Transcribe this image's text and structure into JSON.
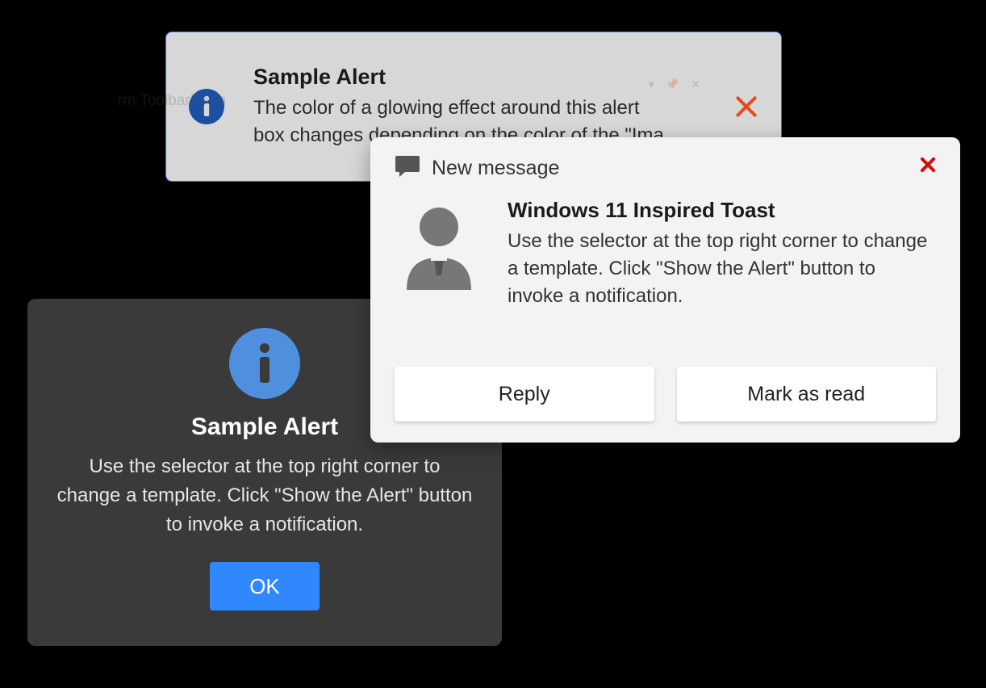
{
  "alert1": {
    "title": "Sample Alert",
    "body": "The color of a glowing effect around this alert box changes depending on the color of the \"Ima",
    "ghost_text": "rm.ToolbarForm",
    "colors": {
      "border": "#3b6fd6",
      "background": "#d7d7d7",
      "close": "#e34a1f"
    }
  },
  "toast": {
    "header": "New message",
    "heading": "Windows 11 Inspired Toast",
    "desc": "Use the selector at the top right corner to change a template. Click \"Show the Alert\" button to invoke a notification.",
    "actions": {
      "reply": "Reply",
      "mark_as_read": "Mark as read"
    },
    "colors": {
      "background": "#f3f3f3",
      "close": "#d60b0b"
    }
  },
  "alert2": {
    "title": "Sample Alert",
    "body": "Use the selector at the top right corner to change a template. Click \"Show the Alert\" button to invoke a notification.",
    "ok": "OK",
    "colors": {
      "background": "#3a3a3a",
      "info_icon": "#4f90de",
      "ok_button": "#2f88ff"
    }
  }
}
